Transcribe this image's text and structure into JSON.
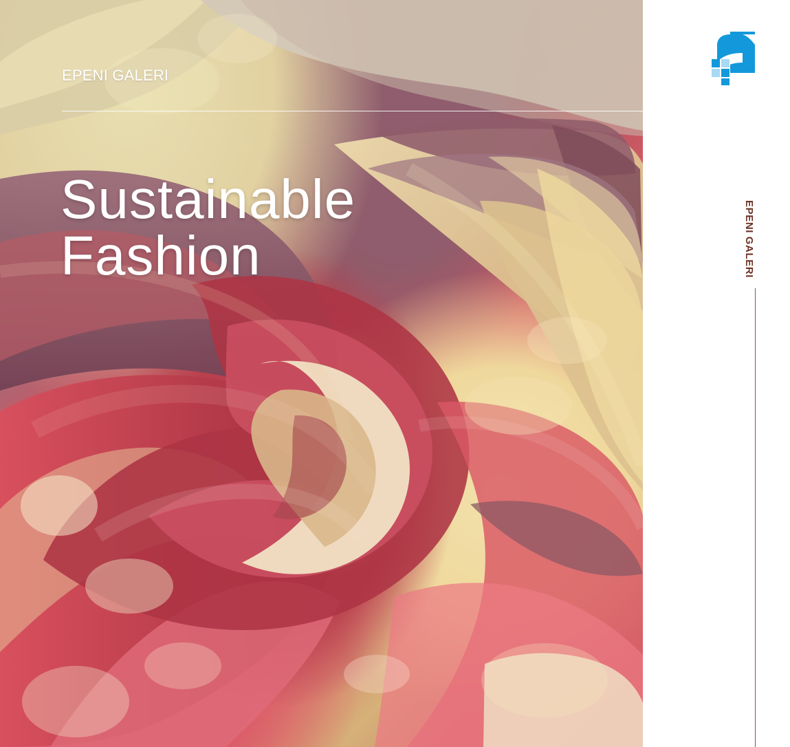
{
  "brand": {
    "top_label": "EPENI GALERI",
    "side_label": "EPENI GALERI",
    "logo_icon": "blue-logo-icon"
  },
  "hero": {
    "title_line_1": "Sustainable",
    "title_line_2": "Fashion",
    "image_icon": "draped-eco-print-fabric"
  },
  "colors": {
    "brand_blue": "#1398dc",
    "accent_brown": "#6d3326",
    "text_white": "#ffffff"
  }
}
